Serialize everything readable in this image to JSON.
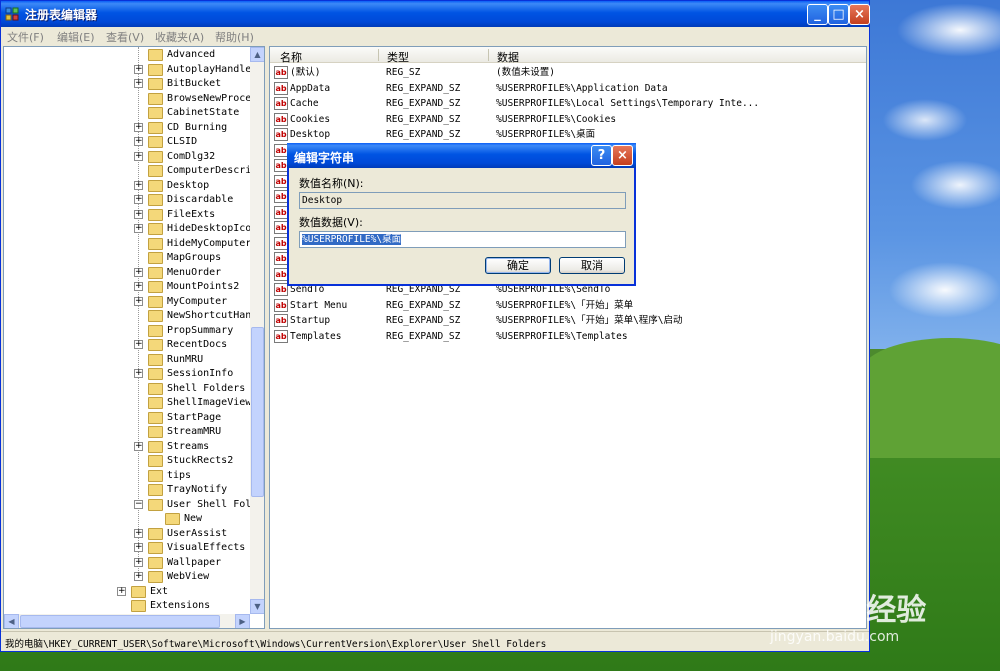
{
  "window": {
    "title": "注册表编辑器",
    "menu": [
      "文件(F)",
      "编辑(E)",
      "查看(V)",
      "收藏夹(A)",
      "帮助(H)"
    ]
  },
  "tree": {
    "items": [
      {
        "label": "Advanced",
        "expandable": false
      },
      {
        "label": "AutoplayHandler",
        "expandable": true
      },
      {
        "label": "BitBucket",
        "expandable": true
      },
      {
        "label": "BrowseNewProces",
        "expandable": false
      },
      {
        "label": "CabinetState",
        "expandable": false
      },
      {
        "label": "CD Burning",
        "expandable": true
      },
      {
        "label": "CLSID",
        "expandable": true
      },
      {
        "label": "ComDlg32",
        "expandable": true
      },
      {
        "label": "ComputerDescrip",
        "expandable": false
      },
      {
        "label": "Desktop",
        "expandable": true
      },
      {
        "label": "Discardable",
        "expandable": true
      },
      {
        "label": "FileExts",
        "expandable": true
      },
      {
        "label": "HideDesktopIcon",
        "expandable": true
      },
      {
        "label": "HideMyComputerI",
        "expandable": false
      },
      {
        "label": "MapGroups",
        "expandable": false
      },
      {
        "label": "MenuOrder",
        "expandable": true
      },
      {
        "label": "MountPoints2",
        "expandable": true
      },
      {
        "label": "MyComputer",
        "expandable": true
      },
      {
        "label": "NewShortcutHand",
        "expandable": false
      },
      {
        "label": "PropSummary",
        "expandable": false
      },
      {
        "label": "RecentDocs",
        "expandable": true
      },
      {
        "label": "RunMRU",
        "expandable": false
      },
      {
        "label": "SessionInfo",
        "expandable": true
      },
      {
        "label": "Shell Folders",
        "expandable": false
      },
      {
        "label": "ShellImageView",
        "expandable": false
      },
      {
        "label": "StartPage",
        "expandable": false
      },
      {
        "label": "StreamMRU",
        "expandable": false
      },
      {
        "label": "Streams",
        "expandable": true
      },
      {
        "label": "StuckRects2",
        "expandable": false
      },
      {
        "label": "tips",
        "expandable": false
      },
      {
        "label": "TrayNotify",
        "expandable": false
      },
      {
        "label": "User Shell Fold",
        "expandable": true,
        "expanded": true
      },
      {
        "label": "New",
        "expandable": false,
        "child": true
      },
      {
        "label": "UserAssist",
        "expandable": true
      },
      {
        "label": "VisualEffects",
        "expandable": true
      },
      {
        "label": "Wallpaper",
        "expandable": true
      },
      {
        "label": "WebView",
        "expandable": true
      },
      {
        "label": "Ext",
        "expandable": true,
        "level": "up"
      },
      {
        "label": "Extensions",
        "expandable": false,
        "level": "up"
      }
    ]
  },
  "list": {
    "columns": [
      "名称",
      "类型",
      "数据"
    ],
    "rows": [
      {
        "name": "(默认)",
        "type": "REG_SZ",
        "data": "(数值未设置)"
      },
      {
        "name": "AppData",
        "type": "REG_EXPAND_SZ",
        "data": "%USERPROFILE%\\Application Data"
      },
      {
        "name": "Cache",
        "type": "REG_EXPAND_SZ",
        "data": "%USERPROFILE%\\Local Settings\\Temporary Inte..."
      },
      {
        "name": "Cookies",
        "type": "REG_EXPAND_SZ",
        "data": "%USERPROFILE%\\Cookies"
      },
      {
        "name": "Desktop",
        "type": "REG_EXPAND_SZ",
        "data": "%USERPROFILE%\\桌面"
      },
      {
        "name": "",
        "type": "",
        "data": ""
      },
      {
        "name": "",
        "type": "",
        "data": "gs\\History"
      },
      {
        "name": "",
        "type": "",
        "data": "gs\\Application Data"
      },
      {
        "name": "",
        "type": "",
        "data": "gs"
      },
      {
        "name": "",
        "type": "",
        "data": "\\My Pictures"
      },
      {
        "name": "",
        "type": "",
        "data": ""
      },
      {
        "name": "",
        "type": "",
        "data": ""
      },
      {
        "name": "",
        "type": "",
        "data": ""
      },
      {
        "name": "",
        "type": "",
        "data": "\\程序"
      },
      {
        "name": "SendTo",
        "type": "REG_EXPAND_SZ",
        "data": "%USERPROFILE%\\SendTo"
      },
      {
        "name": "Start Menu",
        "type": "REG_EXPAND_SZ",
        "data": "%USERPROFILE%\\「开始」菜单"
      },
      {
        "name": "Startup",
        "type": "REG_EXPAND_SZ",
        "data": "%USERPROFILE%\\「开始」菜单\\程序\\启动"
      },
      {
        "name": "Templates",
        "type": "REG_EXPAND_SZ",
        "data": "%USERPROFILE%\\Templates"
      }
    ]
  },
  "statusbar": {
    "path": "我的电脑\\HKEY_CURRENT_USER\\Software\\Microsoft\\Windows\\CurrentVersion\\Explorer\\User Shell Folders"
  },
  "dialog": {
    "title": "编辑字符串",
    "name_label": "数值名称(N):",
    "name_value": "Desktop",
    "data_label": "数值数据(V):",
    "data_value": "%USERPROFILE%\\桌面",
    "ok_label": "确定",
    "cancel_label": "取消",
    "help_glyph": "?"
  },
  "watermark": {
    "main": "Baidu经验",
    "sub": "jingyan.baidu.com"
  },
  "icons": {
    "app": "regedit-icon",
    "string_value": "reg-sz-icon",
    "folder": "folder-icon"
  }
}
